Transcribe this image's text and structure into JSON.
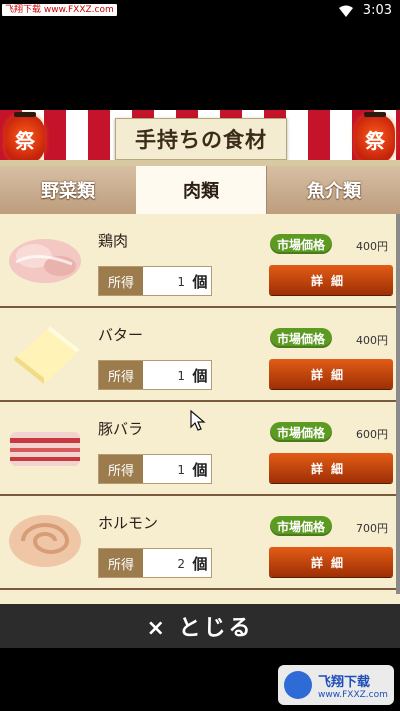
{
  "status_bar": {
    "site_badge": "飞翔下载 www.FXXZ.com",
    "time": "3:03"
  },
  "header": {
    "title": "手持ちの食材",
    "lantern_left": "祭",
    "lantern_right": "祭"
  },
  "tabs": [
    {
      "label": "野菜類",
      "active": false
    },
    {
      "label": "肉類",
      "active": true
    },
    {
      "label": "魚介類",
      "active": false
    }
  ],
  "items": [
    {
      "name": "鶏肉",
      "owned_label": "所得",
      "count": "1",
      "unit": "個",
      "price_label": "市場価格",
      "price": "400円",
      "detail_label": "詳細"
    },
    {
      "name": "バター",
      "owned_label": "所得",
      "count": "1",
      "unit": "個",
      "price_label": "市場価格",
      "price": "400円",
      "detail_label": "詳細"
    },
    {
      "name": "豚バラ",
      "owned_label": "所得",
      "count": "1",
      "unit": "個",
      "price_label": "市場価格",
      "price": "600円",
      "detail_label": "詳細"
    },
    {
      "name": "ホルモン",
      "owned_label": "所得",
      "count": "2",
      "unit": "個",
      "price_label": "市場価格",
      "price": "700円",
      "detail_label": "詳細"
    }
  ],
  "close_button": {
    "label": "× とじる"
  },
  "watermark": {
    "title": "飞翔下载",
    "url": "www.FXXZ.com"
  }
}
